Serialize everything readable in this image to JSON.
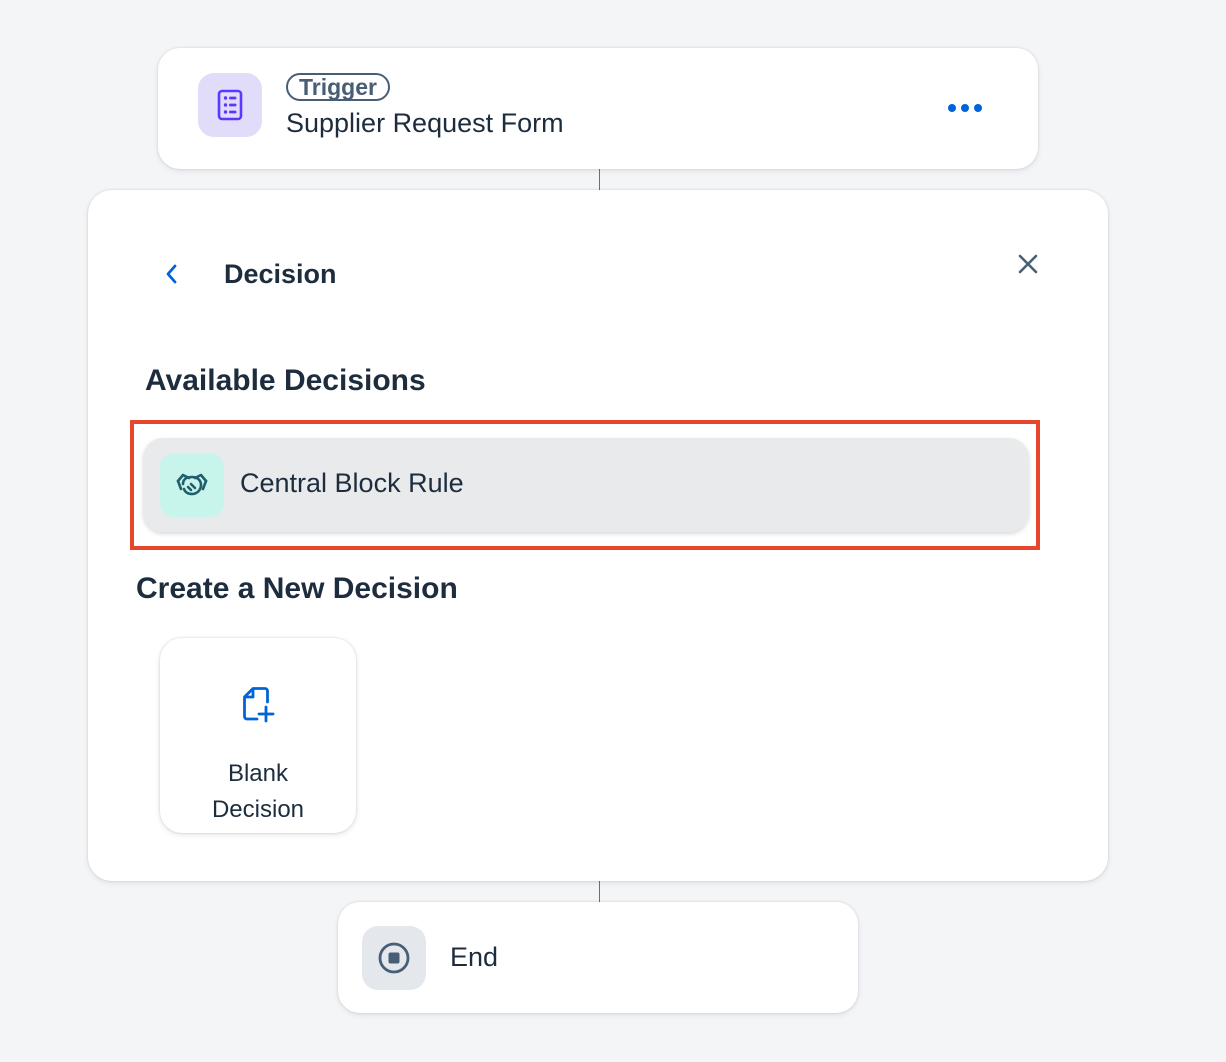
{
  "trigger_card": {
    "badge": "Trigger",
    "title": "Supplier Request Form",
    "icon": "form-icon",
    "more_icon": "more-horizontal-icon"
  },
  "decision_panel": {
    "title": "Decision",
    "back_icon": "chevron-left-icon",
    "close_icon": "close-icon",
    "available_heading": "Available Decisions",
    "available_decisions": [
      {
        "label": "Central Block Rule",
        "icon": "handshake-icon"
      }
    ],
    "create_heading": "Create a New Decision",
    "create_options": [
      {
        "label_line1": "Blank",
        "label_line2": "Decision",
        "icon": "new-document-icon"
      }
    ]
  },
  "end_card": {
    "label": "End",
    "icon": "stop-icon"
  },
  "colors": {
    "background": "#f4f5f7",
    "text": "#1d2d3e",
    "accent_blue": "#0064d9",
    "highlight_red": "#e8462c",
    "trigger_icon_bg": "#e2dcfb",
    "decision_icon_bg": "#c7f4eb"
  }
}
